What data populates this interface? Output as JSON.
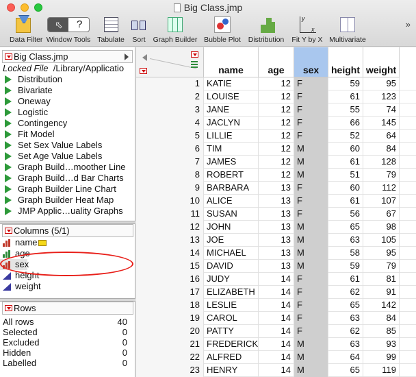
{
  "window": {
    "title": "Big Class.jmp"
  },
  "toolbar": {
    "data_filter": "Data Filter",
    "window_tools": "Window Tools",
    "tabulate": "Tabulate",
    "sort": "Sort",
    "graph_builder": "Graph Builder",
    "bubble_plot": "Bubble Plot",
    "distribution": "Distribution",
    "fit_y_by_x": "Fit Y by X",
    "multivariate": "Multivariate",
    "window_tools_q": "?",
    "fit_icon_y": "y",
    "fit_icon_x": "x"
  },
  "table_panel": {
    "title": "Big Class.jmp",
    "locked_label": "Locked File",
    "locked_path": "/Library/Applicatio",
    "scripts": [
      "Distribution",
      "Bivariate",
      "Oneway",
      "Logistic",
      "Contingency",
      "Fit Model",
      "Set Sex Value Labels",
      "Set Age Value Labels",
      "Graph Build…moother Line",
      "Graph Build…d Bar Charts",
      "Graph Builder Line Chart",
      "Graph Builder Heat Map",
      "JMP Applic…uality Graphs"
    ]
  },
  "columns_panel": {
    "title": "Columns (5/1)",
    "columns": [
      {
        "name": "name",
        "type": "nominal"
      },
      {
        "name": "age",
        "type": "ordinal"
      },
      {
        "name": "sex",
        "type": "nominal"
      },
      {
        "name": "height",
        "type": "continuous"
      },
      {
        "name": "weight",
        "type": "continuous"
      }
    ]
  },
  "rows_panel": {
    "title": "Rows",
    "stats": [
      {
        "label": "All rows",
        "value": "40"
      },
      {
        "label": "Selected",
        "value": "0"
      },
      {
        "label": "Excluded",
        "value": "0"
      },
      {
        "label": "Hidden",
        "value": "0"
      },
      {
        "label": "Labelled",
        "value": "0"
      }
    ]
  },
  "grid": {
    "headers": [
      "name",
      "age",
      "sex",
      "height",
      "weight"
    ],
    "selected_column": "sex",
    "rows": [
      [
        "1",
        "KATIE",
        "12",
        "F",
        "59",
        "95"
      ],
      [
        "2",
        "LOUISE",
        "12",
        "F",
        "61",
        "123"
      ],
      [
        "3",
        "JANE",
        "12",
        "F",
        "55",
        "74"
      ],
      [
        "4",
        "JACLYN",
        "12",
        "F",
        "66",
        "145"
      ],
      [
        "5",
        "LILLIE",
        "12",
        "F",
        "52",
        "64"
      ],
      [
        "6",
        "TIM",
        "12",
        "M",
        "60",
        "84"
      ],
      [
        "7",
        "JAMES",
        "12",
        "M",
        "61",
        "128"
      ],
      [
        "8",
        "ROBERT",
        "12",
        "M",
        "51",
        "79"
      ],
      [
        "9",
        "BARBARA",
        "13",
        "F",
        "60",
        "112"
      ],
      [
        "10",
        "ALICE",
        "13",
        "F",
        "61",
        "107"
      ],
      [
        "11",
        "SUSAN",
        "13",
        "F",
        "56",
        "67"
      ],
      [
        "12",
        "JOHN",
        "13",
        "M",
        "65",
        "98"
      ],
      [
        "13",
        "JOE",
        "13",
        "M",
        "63",
        "105"
      ],
      [
        "14",
        "MICHAEL",
        "13",
        "M",
        "58",
        "95"
      ],
      [
        "15",
        "DAVID",
        "13",
        "M",
        "59",
        "79"
      ],
      [
        "16",
        "JUDY",
        "14",
        "F",
        "61",
        "81"
      ],
      [
        "17",
        "ELIZABETH",
        "14",
        "F",
        "62",
        "91"
      ],
      [
        "18",
        "LESLIE",
        "14",
        "F",
        "65",
        "142"
      ],
      [
        "19",
        "CAROL",
        "14",
        "F",
        "63",
        "84"
      ],
      [
        "20",
        "PATTY",
        "14",
        "F",
        "62",
        "85"
      ],
      [
        "21",
        "FREDERICK",
        "14",
        "M",
        "63",
        "93"
      ],
      [
        "22",
        "ALFRED",
        "14",
        "M",
        "64",
        "99"
      ],
      [
        "23",
        "HENRY",
        "14",
        "M",
        "65",
        "119"
      ]
    ]
  },
  "colors": {
    "selected_header": "#a9c7ee",
    "script_play": "#2e9a3a",
    "annotation": "#e8201a"
  }
}
